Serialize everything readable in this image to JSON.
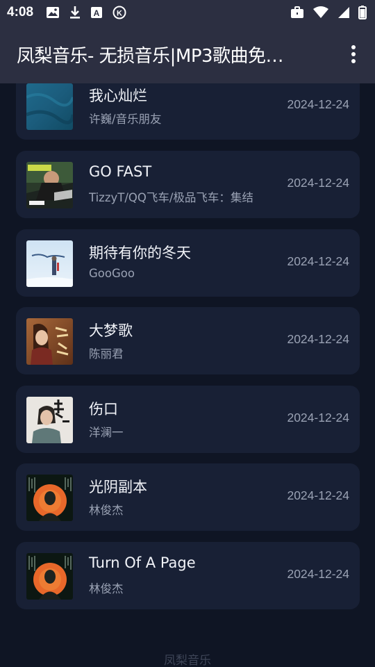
{
  "status_bar": {
    "time": "4:08",
    "left_icons": [
      "image-icon",
      "download-icon",
      "a-box-icon",
      "k-circle-icon"
    ],
    "right_icons": [
      "briefcase-icon",
      "wifi-icon",
      "signal-icon",
      "battery-icon"
    ]
  },
  "app_bar": {
    "title": "凤梨音乐- 无损音乐|MP3歌曲免…",
    "overflow_icon": "more-vert-icon"
  },
  "songs": [
    {
      "title": "我心灿烂",
      "artist": "许巍/音乐朋友",
      "date": "2024-12-24",
      "cover_icon": "album-cover-blue"
    },
    {
      "title": "GO FAST",
      "artist": "TizzyT/QQ飞车/极品飞车：集结",
      "date": "2024-12-24",
      "cover_icon": "album-cover-gofast"
    },
    {
      "title": "期待有你的冬天",
      "artist": "GooGoo",
      "date": "2024-12-24",
      "cover_icon": "album-cover-winter"
    },
    {
      "title": "大梦歌",
      "artist": "陈丽君",
      "date": "2024-12-24",
      "cover_icon": "album-cover-dream"
    },
    {
      "title": "伤口",
      "artist": "洋澜一",
      "date": "2024-12-24",
      "cover_icon": "album-cover-wound"
    },
    {
      "title": "光阴副本",
      "artist": "林俊杰",
      "date": "2024-12-24",
      "cover_icon": "album-cover-jj-orange"
    },
    {
      "title": "Turn Of A Page",
      "artist": "林俊杰",
      "date": "2024-12-24",
      "cover_icon": "album-cover-jj-orange"
    }
  ],
  "footer": {
    "text": "凤梨音乐"
  },
  "colors": {
    "background": "#0f1524",
    "card": "#182035",
    "app_bar": "#2c2f41",
    "secondary_text": "#9aa2b4"
  }
}
